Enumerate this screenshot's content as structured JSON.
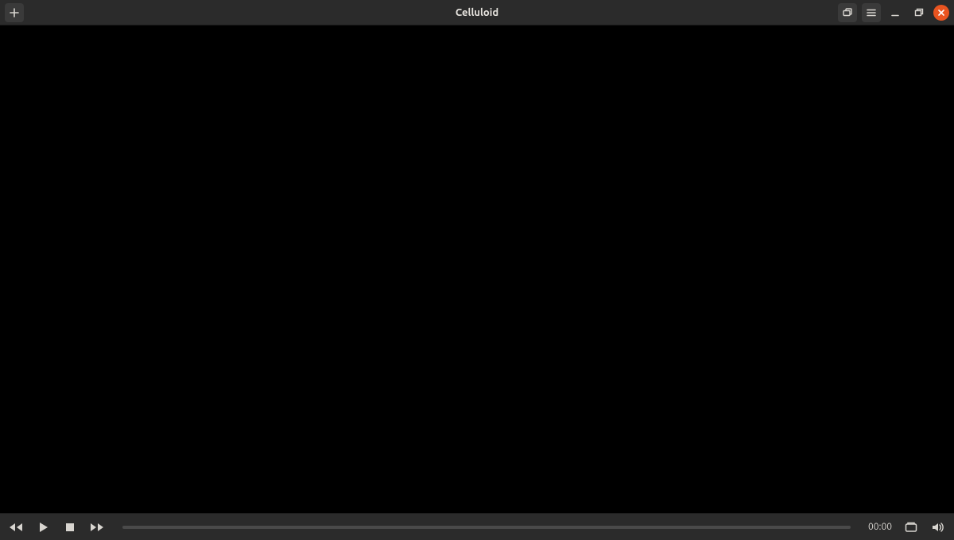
{
  "header": {
    "title": "Celluloid",
    "icons": {
      "add": "plus-icon",
      "fullscreen": "fullscreen-toggle-icon",
      "menu": "hamburger-icon",
      "minimize": "minimize-icon",
      "maximize": "maximize-restore-icon",
      "close": "close-icon"
    }
  },
  "playback": {
    "time_display": "00:00",
    "icons": {
      "rewind": "rewind-icon",
      "play": "play-icon",
      "stop": "stop-icon",
      "forward": "fast-forward-icon",
      "playlist": "playlist-icon",
      "volume": "volume-icon"
    }
  },
  "colors": {
    "headerbar": "#2b2b2b",
    "accent_close": "#e95420",
    "icon": "#d8d5d0"
  }
}
